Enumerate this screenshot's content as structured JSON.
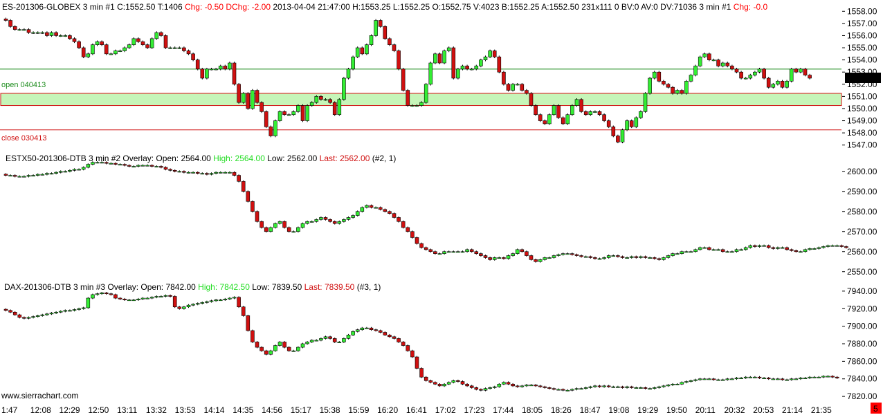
{
  "colors": {
    "up": "#33ee33",
    "down": "#d01010",
    "wick": "#000000",
    "open_line": "#1c8c1c",
    "close_line": "#d01010",
    "zone_fill": "#c6f5b8",
    "zone_border": "#d01010",
    "chg_text": "#ff0000",
    "high_text": "#22dd22",
    "last_box": "#000000",
    "corner_badge": "#ff0000"
  },
  "chart_data": [
    {
      "type": "candlestick",
      "title": "ES-201306-GLOBEX  3 min",
      "header": {
        "main": "ES-201306-GLOBEX  3 min   #1 C:1552.50 T:1406 ",
        "chg": "Chg: -0.50 DChg: -2.00",
        "stats": " 2013-04-04 21:47:00 H:1553.25 L:1552.25 O:1552.75 V:4023 B:1552.25 A:1552.50 231x111 0 BV:0 AV:0 DV:71036 3 min  #1 ",
        "chg2": "Chg: -0.0"
      },
      "ylim": [
        1546.3,
        1558.7
      ],
      "yticks": [
        1547,
        1548,
        1549,
        1550,
        1551,
        1552,
        1553,
        1554,
        1555,
        1556,
        1557,
        1558
      ],
      "ytick_labels": [
        "1547.00",
        "1548.00",
        "1549.00",
        "1550.00",
        "1551.00",
        "1552.00",
        "1553.00",
        "1554.00",
        "1555.00",
        "1556.00",
        "1557.00",
        "1558.00"
      ],
      "last_label": "1552.50",
      "levels": [
        {
          "name": "open 040413",
          "value": 1553.25
        },
        {
          "name": "close 030413",
          "value": 1548.25
        }
      ],
      "zone": [
        1550.25,
        1551.25
      ],
      "closes": [
        1557.25,
        1556.75,
        1556.5,
        1556.5,
        1556.5,
        1556.25,
        1556.25,
        1556.25,
        1556.25,
        1556.0,
        1556.25,
        1556.0,
        1556.0,
        1556.0,
        1555.75,
        1555.5,
        1555.0,
        1554.25,
        1554.5,
        1555.25,
        1555.5,
        1555.25,
        1554.5,
        1554.5,
        1554.75,
        1554.75,
        1555.0,
        1555.25,
        1555.75,
        1555.5,
        1555.25,
        1555.0,
        1555.75,
        1556.25,
        1556.0,
        1555.0,
        1555.0,
        1555.0,
        1555.0,
        1554.75,
        1554.5,
        1554.0,
        1553.25,
        1552.5,
        1553.25,
        1553.25,
        1553.25,
        1553.5,
        1553.25,
        1553.75,
        1552.0,
        1550.5,
        1551.25,
        1550.0,
        1551.5,
        1550.5,
        1549.75,
        1548.5,
        1547.75,
        1549.0,
        1549.75,
        1549.5,
        1549.5,
        1549.75,
        1550.25,
        1549.0,
        1550.25,
        1550.5,
        1551.0,
        1550.75,
        1550.75,
        1550.5,
        1549.5,
        1550.75,
        1552.5,
        1553.25,
        1554.25,
        1555.0,
        1554.5,
        1555.25,
        1556.0,
        1557.25,
        1556.75,
        1555.75,
        1555.25,
        1554.75,
        1553.25,
        1551.5,
        1550.25,
        1550.25,
        1550.25,
        1550.5,
        1552.0,
        1553.75,
        1554.5,
        1553.75,
        1554.75,
        1555.0,
        1552.5,
        1553.25,
        1553.5,
        1553.25,
        1553.25,
        1553.5,
        1554.0,
        1554.25,
        1554.75,
        1554.25,
        1553.0,
        1552.0,
        1551.5,
        1552.0,
        1552.0,
        1551.5,
        1551.25,
        1550.25,
        1549.5,
        1549.0,
        1548.75,
        1549.5,
        1550.25,
        1549.25,
        1548.75,
        1549.5,
        1550.25,
        1550.75,
        1549.75,
        1549.5,
        1549.75,
        1549.75,
        1549.5,
        1549.0,
        1548.5,
        1547.75,
        1547.25,
        1548.25,
        1549.0,
        1548.5,
        1549.25,
        1549.75,
        1551.25,
        1552.5,
        1553.0,
        1552.25,
        1552.0,
        1551.75,
        1551.25,
        1551.5,
        1551.25,
        1552.25,
        1552.75,
        1553.5,
        1554.25,
        1554.5,
        1554.0,
        1554.0,
        1553.5,
        1553.75,
        1553.5,
        1553.25,
        1553.0,
        1552.5,
        1552.5,
        1552.75,
        1553.0,
        1553.25,
        1552.5,
        1551.75,
        1552.0,
        1552.25,
        1551.75,
        1552.25,
        1553.25,
        1553.0,
        1553.25,
        1552.75,
        1552.5
      ]
    },
    {
      "type": "candlestick",
      "title": "ESTX50-201306-DTB  3 min",
      "header": {
        "main": "ESTX50-201306-DTB  3 min   #2 Overlay:  Open: 2564.00  ",
        "high": "High: 2564.00",
        "low": "  Low: 2562.00  ",
        "last": "Last: 2562.00",
        "tail": "   (#2, 1)"
      },
      "ylim": [
        2547.5,
        2607.5
      ],
      "yticks": [
        2550,
        2560,
        2570,
        2580,
        2590,
        2600
      ],
      "ytick_labels": [
        "2550.00",
        "2560.00",
        "2570.00",
        "2580.00",
        "2590.00",
        "2600.00"
      ],
      "closes": [
        2598.0,
        2598.0,
        2597.5,
        2597.5,
        2597.5,
        2598.0,
        2598.0,
        2598.5,
        2598.5,
        2599.0,
        2599.0,
        2599.5,
        2600.0,
        2600.0,
        2600.5,
        2601.0,
        2601.0,
        2602.0,
        2603.5,
        2604.5,
        2604.5,
        2604.5,
        2604.0,
        2604.0,
        2603.5,
        2603.5,
        2603.0,
        2602.5,
        2602.5,
        2603.0,
        2603.0,
        2603.0,
        2602.5,
        2602.5,
        2602.0,
        2601.0,
        2600.5,
        2600.0,
        2600.0,
        2599.5,
        2599.5,
        2599.5,
        2599.0,
        2599.0,
        2598.5,
        2599.0,
        2599.5,
        2599.5,
        2599.5,
        2599.5,
        2598.0,
        2595.0,
        2590.0,
        2585.0,
        2580.0,
        2575.0,
        2572.0,
        2570.0,
        2572.0,
        2574.0,
        2575.0,
        2572.0,
        2570.0,
        2570.0,
        2572.0,
        2574.0,
        2575.0,
        2575.0,
        2576.0,
        2577.0,
        2576.0,
        2575.0,
        2574.0,
        2575.0,
        2576.0,
        2577.0,
        2578.0,
        2580.0,
        2582.0,
        2583.0,
        2582.0,
        2582.0,
        2581.0,
        2580.0,
        2579.0,
        2577.0,
        2575.0,
        2572.0,
        2570.0,
        2567.0,
        2564.0,
        2562.0,
        2561.0,
        2560.0,
        2559.0,
        2559.0,
        2560.0,
        2560.0,
        2560.0,
        2560.0,
        2560.0,
        2561.0,
        2560.0,
        2559.0,
        2558.0,
        2557.0,
        2556.0,
        2557.0,
        2557.0,
        2556.5,
        2558.0,
        2559.0,
        2561.0,
        2560.0,
        2558.0,
        2556.0,
        2555.0,
        2556.0,
        2557.0,
        2557.0,
        2558.0,
        2558.5,
        2559.0,
        2559.0,
        2558.5,
        2558.0,
        2557.5,
        2557.5,
        2557.0,
        2556.5,
        2556.5,
        2557.0,
        2558.0,
        2558.0,
        2557.5,
        2557.0,
        2557.0,
        2557.5,
        2557.0,
        2557.5,
        2557.0,
        2557.0,
        2556.5,
        2556.0,
        2557.0,
        2558.0,
        2559.0,
        2559.0,
        2560.0,
        2560.0,
        2560.0,
        2561.0,
        2562.0,
        2562.0,
        2561.0,
        2561.0,
        2561.0,
        2560.0,
        2560.0,
        2560.0,
        2561.0,
        2561.0,
        2562.0,
        2563.0,
        2562.5,
        2563.0,
        2563.0,
        2562.0,
        2561.5,
        2562.0,
        2562.0,
        2561.0,
        2560.5,
        2560.0,
        2560.0,
        2561.0,
        2561.5,
        2561.5,
        2562.0,
        2562.5,
        2563.0,
        2563.0,
        2563.0,
        2562.5,
        2562.0
      ]
    },
    {
      "type": "candlestick",
      "title": "DAX-201306-DTB  3 min",
      "header": {
        "main": "DAX-201306-DTB  3 min   #3 Overlay:  Open: 7842.00  ",
        "high": "High: 7842.50",
        "low": "  Low: 7839.50  ",
        "last": "Last: 7839.50",
        "tail": "   (#3, 1)"
      },
      "ylim": [
        7813,
        7947
      ],
      "yticks": [
        7820,
        7840,
        7860,
        7880,
        7900,
        7920,
        7940
      ],
      "ytick_labels": [
        "7820.00",
        "7840.00",
        "7860.00",
        "7880.00",
        "7900.00",
        "7920.00",
        "7940.00"
      ],
      "closes": [
        7918.0,
        7916.0,
        7913.0,
        7910.0,
        7909.0,
        7910.0,
        7911.0,
        7912.0,
        7913.0,
        7914.0,
        7915.0,
        7916.0,
        7917.0,
        7918.0,
        7918.0,
        7919.0,
        7920.0,
        7921.0,
        7932.0,
        7936.0,
        7937.0,
        7938.0,
        7937.0,
        7936.0,
        7932.0,
        7931.0,
        7930.0,
        7930.0,
        7930.0,
        7931.0,
        7932.0,
        7932.0,
        7933.0,
        7934.0,
        7934.0,
        7935.0,
        7934.0,
        7922.0,
        7920.0,
        7922.0,
        7924.0,
        7925.0,
        7926.0,
        7927.0,
        7928.0,
        7929.0,
        7930.0,
        7930.0,
        7931.0,
        7932.0,
        7933.0,
        7922.0,
        7912.0,
        7895.0,
        7882.0,
        7876.0,
        7872.0,
        7868.0,
        7872.0,
        7878.0,
        7882.0,
        7876.0,
        7872.0,
        7872.0,
        7876.0,
        7880.0,
        7882.0,
        7884.0,
        7884.0,
        7886.0,
        7888.0,
        7886.0,
        7882.0,
        7882.0,
        7886.0,
        7890.0,
        7894.0,
        7896.0,
        7898.0,
        7898.0,
        7896.0,
        7895.0,
        7893.0,
        7890.0,
        7888.0,
        7886.0,
        7882.0,
        7878.0,
        7872.0,
        7865.0,
        7852.0,
        7842.0,
        7838.0,
        7836.0,
        7834.0,
        7832.0,
        7834.0,
        7836.0,
        7838.0,
        7837.0,
        7834.0,
        7832.0,
        7830.0,
        7828.0,
        7827.0,
        7829.0,
        7830.0,
        7831.0,
        7834.0,
        7836.0,
        7834.0,
        7832.0,
        7831.0,
        7832.0,
        7833.0,
        7833.0,
        7832.0,
        7831.0,
        7830.0,
        7829.0,
        7828.0,
        7828.0,
        7827.0,
        7827.0,
        7828.0,
        7829.0,
        7829.0,
        7830.0,
        7831.0,
        7832.0,
        7831.0,
        7832.0,
        7831.0,
        7831.0,
        7831.0,
        7830.0,
        7831.0,
        7830.0,
        7830.0,
        7830.0,
        7829.0,
        7829.0,
        7830.0,
        7831.0,
        7832.0,
        7833.0,
        7834.0,
        7834.0,
        7836.0,
        7837.0,
        7838.0,
        7839.0,
        7840.0,
        7840.0,
        7840.0,
        7839.0,
        7839.0,
        7839.0,
        7840.0,
        7840.0,
        7841.0,
        7841.0,
        7842.0,
        7842.0,
        7842.0,
        7841.0,
        7841.0,
        7840.0,
        7840.0,
        7840.0,
        7839.0,
        7839.0,
        7840.0,
        7840.0,
        7841.0,
        7841.0,
        7842.0,
        7842.0,
        7842.0,
        7843.0,
        7843.0,
        7842.0,
        7841.0
      ]
    }
  ],
  "x_axis": {
    "labels": [
      "1:47",
      "12:08",
      "12:29",
      "12:50",
      "13:11",
      "13:32",
      "13:53",
      "14:14",
      "14:35",
      "14:56",
      "15:17",
      "15:38",
      "15:59",
      "16:20",
      "16:41",
      "17:02",
      "17:23",
      "17:44",
      "18:05",
      "18:26",
      "18:47",
      "19:08",
      "19:29",
      "19:50",
      "20:11",
      "20:32",
      "20:53",
      "21:14",
      "21:35"
    ]
  },
  "watermark": "www.sierrachart.com",
  "corner_badge_label": "5"
}
